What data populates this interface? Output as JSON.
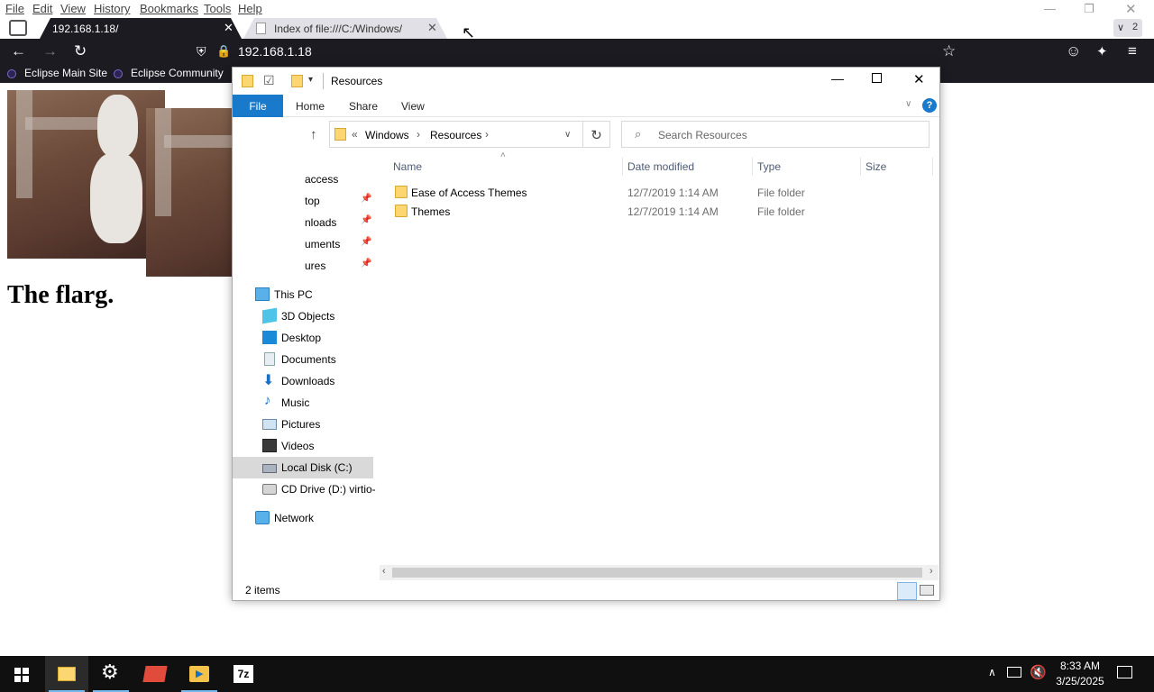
{
  "browser": {
    "menu": [
      "File",
      "Edit",
      "View",
      "History",
      "Bookmarks",
      "Tools",
      "Help"
    ],
    "tabs": [
      {
        "title": "192.168.1.18/",
        "active": true
      },
      {
        "title": "Index of file:///C:/Windows/",
        "active": false
      }
    ],
    "tab_count": "2",
    "url": "192.168.1.18",
    "bookmarks": [
      "Eclipse Main Site",
      "Eclipse Community"
    ]
  },
  "page": {
    "heading": "The flarg."
  },
  "explorer": {
    "title": "Resources",
    "ribbon_tabs": [
      "File",
      "Home",
      "Share",
      "View"
    ],
    "breadcrumb": [
      "Windows",
      "Resources"
    ],
    "search_placeholder": "Search Resources",
    "columns": [
      "Name",
      "Date modified",
      "Type",
      "Size"
    ],
    "files": [
      {
        "name": "Ease of Access Themes",
        "date": "12/7/2019 1:14 AM",
        "type": "File folder",
        "size": ""
      },
      {
        "name": "Themes",
        "date": "12/7/2019 1:14 AM",
        "type": "File folder",
        "size": ""
      }
    ],
    "nav": {
      "quick_access_partial": [
        "access",
        "top",
        "nloads",
        "uments",
        "ures"
      ],
      "this_pc": "This PC",
      "pc_items": [
        "3D Objects",
        "Desktop",
        "Documents",
        "Downloads",
        "Music",
        "Pictures",
        "Videos",
        "Local Disk (C:)",
        "CD Drive (D:) virtio-"
      ],
      "network": "Network"
    },
    "status": "2 items"
  },
  "taskbar": {
    "time": "8:33 AM",
    "date": "3/25/2025"
  },
  "colors": {
    "accent": "#1979ca",
    "browser_dark": "#1c1b22",
    "taskbar": "#101010"
  }
}
